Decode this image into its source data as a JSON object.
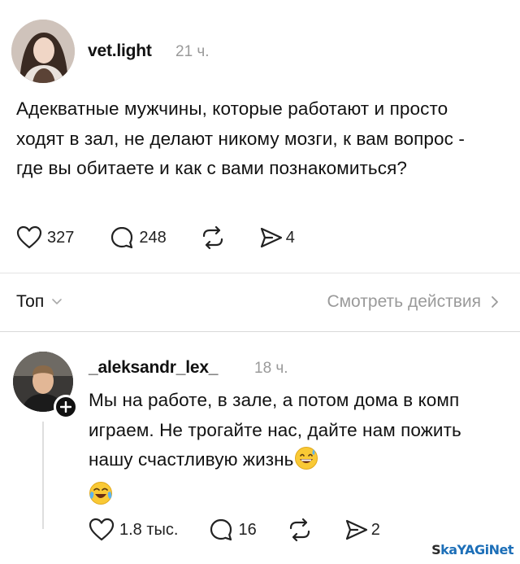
{
  "post": {
    "username": "vet.light",
    "time": "21 ч.",
    "text": "Адекватные мужчины, которые работают и просто ходят в зал, не делают никому мозги, к вам вопрос - где вы обитаете и как с вами познакомиться?",
    "likes": "327",
    "comments": "248",
    "shares": "4",
    "icons": {
      "like": "heart-icon",
      "comment": "comment-bubble-icon",
      "repost": "repost-icon",
      "share": "send-icon"
    }
  },
  "sort_bar": {
    "sort_label": "Топ",
    "view_actions_label": "Смотреть действия"
  },
  "reply": {
    "username": "_aleksandr_lex_",
    "time": "18 ч.",
    "text": "Мы на работе, в зале, а потом дома в комп играем. Не трогайте нас, дайте нам пожить нашу счастливую жизнь",
    "likes": "1.8 тыс.",
    "comments": "16",
    "shares": "2",
    "emojis": [
      "grinning-sweat-emoji",
      "tears-of-joy-emoji"
    ]
  },
  "watermark": {
    "text_part1": "S",
    "text_part2": "kaYAGiNet"
  },
  "colors": {
    "text": "#111111",
    "muted": "#9a9a9a",
    "divider": "#e3e3e3",
    "background": "#ffffff"
  }
}
